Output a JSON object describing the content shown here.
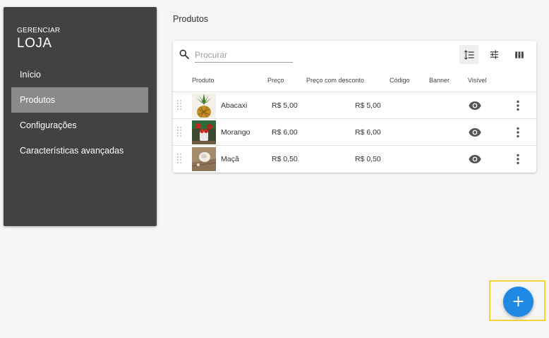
{
  "sidebar": {
    "brand_small": "GERENCIAR",
    "brand_big": "LOJA",
    "items": [
      {
        "label": "Início"
      },
      {
        "label": "Produtos"
      },
      {
        "label": "Configurações"
      },
      {
        "label": "Características avançadas"
      }
    ]
  },
  "page": {
    "title": "Produtos"
  },
  "search": {
    "placeholder": "Procurar"
  },
  "table": {
    "columns": [
      "Produto",
      "Preço",
      "Preço com desconto",
      "Código",
      "Banner",
      "Visível"
    ],
    "rows": [
      {
        "name": "Abacaxi",
        "price": "R$ 5,00",
        "discount_price": "R$ 5,00",
        "code": "",
        "banner": "",
        "visible": true
      },
      {
        "name": "Morango",
        "price": "R$ 6,00",
        "discount_price": "R$ 6,00",
        "code": "",
        "banner": "",
        "visible": true
      },
      {
        "name": "Maçã",
        "price": "R$ 0,50",
        "discount_price": "R$ 0,50",
        "code": "",
        "banner": "",
        "visible": true
      }
    ]
  },
  "fab": {
    "symbol": "+"
  },
  "colors": {
    "sidebar_bg": "#424242",
    "sidebar_active": "#8a8a8a",
    "fab": "#1e88e5",
    "highlight": "#f2d535"
  },
  "icons": {
    "toolbar": [
      "reorder-list-icon",
      "filter-sliders-icon",
      "columns-icon"
    ],
    "row": [
      "drag-handle-icon",
      "eye-icon",
      "more-vert-icon"
    ]
  }
}
